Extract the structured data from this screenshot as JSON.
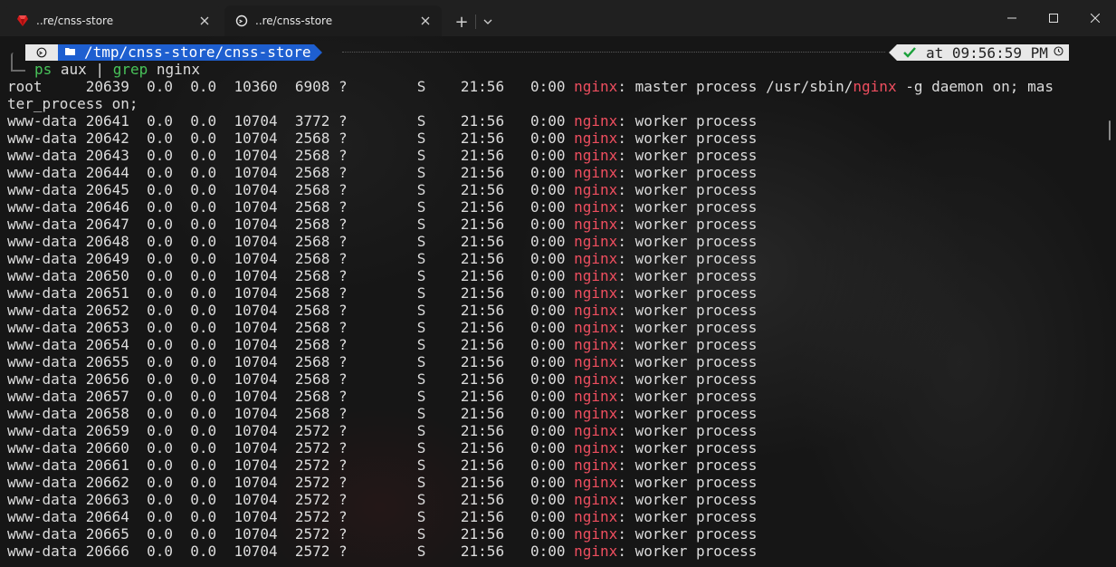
{
  "tabs": [
    {
      "title": "..re/cnss-store",
      "icon": "ruby-icon",
      "active": false
    },
    {
      "title": "..re/cnss-store",
      "icon": "terminal-icon",
      "active": true
    }
  ],
  "window": {
    "new_tab": "+",
    "dropdown": "chevron-down-icon"
  },
  "prompt": {
    "path": "/tmp/cnss-store/cnss-store",
    "status_icon": "checkmark-icon",
    "time": "at 09:56:59 PM"
  },
  "command": {
    "ps": "ps",
    "args1": " aux | ",
    "grep": "grep",
    "args2": " nginx"
  },
  "colors": {
    "highlight": "#ef4e5f",
    "command": "#48c35a",
    "path_segment": "#1e5fd0"
  },
  "processes": [
    {
      "prefix": "root     20639  0.0  0.0  10360  6908 ?        S    21:56   0:00 ",
      "hl1": "nginx",
      "mid": ": master process /usr/sbin/",
      "hl2": "nginx",
      "suffix": " -g daemon on; mas"
    },
    {
      "prefix": "ter_process on;",
      "hl1": "",
      "mid": "",
      "hl2": "",
      "suffix": ""
    },
    {
      "prefix": "www-data 20641  0.0  0.0  10704  3772 ?        S    21:56   0:00 ",
      "hl1": "nginx",
      "mid": ": worker process",
      "hl2": "",
      "suffix": ""
    },
    {
      "prefix": "www-data 20642  0.0  0.0  10704  2568 ?        S    21:56   0:00 ",
      "hl1": "nginx",
      "mid": ": worker process",
      "hl2": "",
      "suffix": ""
    },
    {
      "prefix": "www-data 20643  0.0  0.0  10704  2568 ?        S    21:56   0:00 ",
      "hl1": "nginx",
      "mid": ": worker process",
      "hl2": "",
      "suffix": ""
    },
    {
      "prefix": "www-data 20644  0.0  0.0  10704  2568 ?        S    21:56   0:00 ",
      "hl1": "nginx",
      "mid": ": worker process",
      "hl2": "",
      "suffix": ""
    },
    {
      "prefix": "www-data 20645  0.0  0.0  10704  2568 ?        S    21:56   0:00 ",
      "hl1": "nginx",
      "mid": ": worker process",
      "hl2": "",
      "suffix": ""
    },
    {
      "prefix": "www-data 20646  0.0  0.0  10704  2568 ?        S    21:56   0:00 ",
      "hl1": "nginx",
      "mid": ": worker process",
      "hl2": "",
      "suffix": ""
    },
    {
      "prefix": "www-data 20647  0.0  0.0  10704  2568 ?        S    21:56   0:00 ",
      "hl1": "nginx",
      "mid": ": worker process",
      "hl2": "",
      "suffix": ""
    },
    {
      "prefix": "www-data 20648  0.0  0.0  10704  2568 ?        S    21:56   0:00 ",
      "hl1": "nginx",
      "mid": ": worker process",
      "hl2": "",
      "suffix": ""
    },
    {
      "prefix": "www-data 20649  0.0  0.0  10704  2568 ?        S    21:56   0:00 ",
      "hl1": "nginx",
      "mid": ": worker process",
      "hl2": "",
      "suffix": ""
    },
    {
      "prefix": "www-data 20650  0.0  0.0  10704  2568 ?        S    21:56   0:00 ",
      "hl1": "nginx",
      "mid": ": worker process",
      "hl2": "",
      "suffix": ""
    },
    {
      "prefix": "www-data 20651  0.0  0.0  10704  2568 ?        S    21:56   0:00 ",
      "hl1": "nginx",
      "mid": ": worker process",
      "hl2": "",
      "suffix": ""
    },
    {
      "prefix": "www-data 20652  0.0  0.0  10704  2568 ?        S    21:56   0:00 ",
      "hl1": "nginx",
      "mid": ": worker process",
      "hl2": "",
      "suffix": ""
    },
    {
      "prefix": "www-data 20653  0.0  0.0  10704  2568 ?        S    21:56   0:00 ",
      "hl1": "nginx",
      "mid": ": worker process",
      "hl2": "",
      "suffix": ""
    },
    {
      "prefix": "www-data 20654  0.0  0.0  10704  2568 ?        S    21:56   0:00 ",
      "hl1": "nginx",
      "mid": ": worker process",
      "hl2": "",
      "suffix": ""
    },
    {
      "prefix": "www-data 20655  0.0  0.0  10704  2568 ?        S    21:56   0:00 ",
      "hl1": "nginx",
      "mid": ": worker process",
      "hl2": "",
      "suffix": ""
    },
    {
      "prefix": "www-data 20656  0.0  0.0  10704  2568 ?        S    21:56   0:00 ",
      "hl1": "nginx",
      "mid": ": worker process",
      "hl2": "",
      "suffix": ""
    },
    {
      "prefix": "www-data 20657  0.0  0.0  10704  2568 ?        S    21:56   0:00 ",
      "hl1": "nginx",
      "mid": ": worker process",
      "hl2": "",
      "suffix": ""
    },
    {
      "prefix": "www-data 20658  0.0  0.0  10704  2568 ?        S    21:56   0:00 ",
      "hl1": "nginx",
      "mid": ": worker process",
      "hl2": "",
      "suffix": ""
    },
    {
      "prefix": "www-data 20659  0.0  0.0  10704  2572 ?        S    21:56   0:00 ",
      "hl1": "nginx",
      "mid": ": worker process",
      "hl2": "",
      "suffix": ""
    },
    {
      "prefix": "www-data 20660  0.0  0.0  10704  2572 ?        S    21:56   0:00 ",
      "hl1": "nginx",
      "mid": ": worker process",
      "hl2": "",
      "suffix": ""
    },
    {
      "prefix": "www-data 20661  0.0  0.0  10704  2572 ?        S    21:56   0:00 ",
      "hl1": "nginx",
      "mid": ": worker process",
      "hl2": "",
      "suffix": ""
    },
    {
      "prefix": "www-data 20662  0.0  0.0  10704  2572 ?        S    21:56   0:00 ",
      "hl1": "nginx",
      "mid": ": worker process",
      "hl2": "",
      "suffix": ""
    },
    {
      "prefix": "www-data 20663  0.0  0.0  10704  2572 ?        S    21:56   0:00 ",
      "hl1": "nginx",
      "mid": ": worker process",
      "hl2": "",
      "suffix": ""
    },
    {
      "prefix": "www-data 20664  0.0  0.0  10704  2572 ?        S    21:56   0:00 ",
      "hl1": "nginx",
      "mid": ": worker process",
      "hl2": "",
      "suffix": ""
    },
    {
      "prefix": "www-data 20665  0.0  0.0  10704  2572 ?        S    21:56   0:00 ",
      "hl1": "nginx",
      "mid": ": worker process",
      "hl2": "",
      "suffix": ""
    },
    {
      "prefix": "www-data 20666  0.0  0.0  10704  2572 ?        S    21:56   0:00 ",
      "hl1": "nginx",
      "mid": ": worker process",
      "hl2": "",
      "suffix": ""
    }
  ]
}
